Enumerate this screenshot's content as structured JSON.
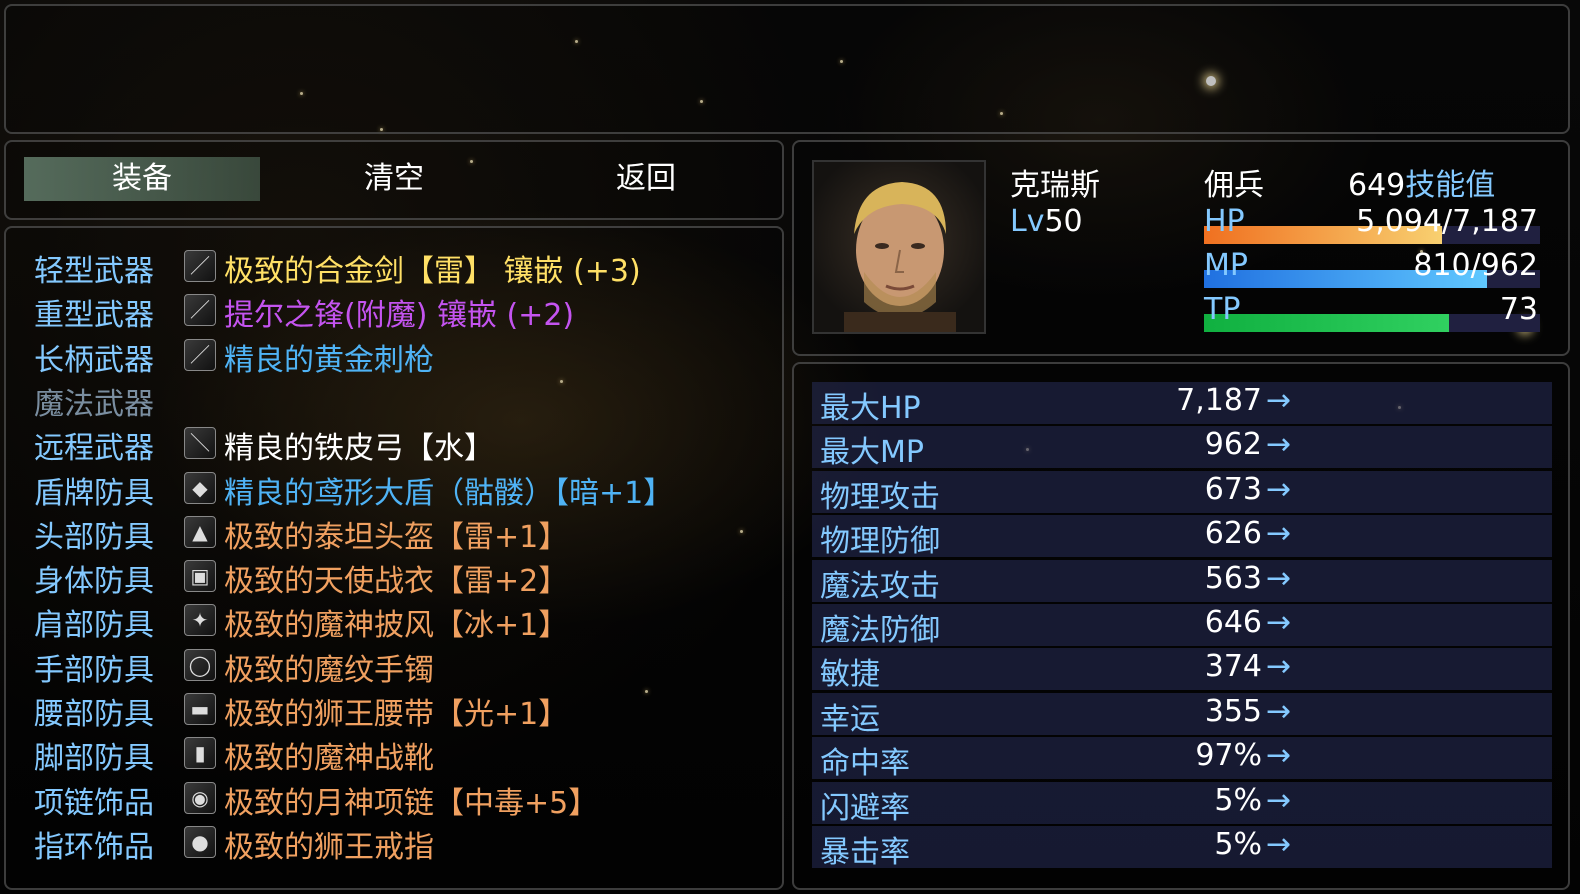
{
  "commands": [
    {
      "label": "装备",
      "selected": true
    },
    {
      "label": "清空",
      "selected": false
    },
    {
      "label": "返回",
      "selected": false
    }
  ],
  "slots": [
    {
      "slot": "轻型武器",
      "icon": "sword-icon",
      "glyph": "／",
      "item": "极致的合金剑【雷】 镶嵌 (+3)",
      "color": "#ffe066",
      "dim": false
    },
    {
      "slot": "重型武器",
      "icon": "greatsword-icon",
      "glyph": "／",
      "item": "提尔之锋(附魔) 镶嵌 (+2)",
      "color": "#c454f0",
      "dim": false
    },
    {
      "slot": "长柄武器",
      "icon": "spear-icon",
      "glyph": "／",
      "item": "精良的黄金刺枪",
      "color": "#4fb3f5",
      "dim": false
    },
    {
      "slot": "魔法武器",
      "icon": "",
      "glyph": "",
      "item": "",
      "color": "#ffffff",
      "dim": true
    },
    {
      "slot": "远程武器",
      "icon": "bow-icon",
      "glyph": "＼",
      "item": "精良的铁皮弓【水】",
      "color": "#ffffff",
      "dim": false
    },
    {
      "slot": "盾牌防具",
      "icon": "shield-icon",
      "glyph": "◆",
      "item": "精良的鸢形大盾（骷髅）【暗+1】",
      "color": "#4fb3f5",
      "dim": false
    },
    {
      "slot": "头部防具",
      "icon": "helmet-icon",
      "glyph": "▲",
      "item": "极致的泰坦头盔【雷+1】",
      "color": "#f0a060",
      "dim": false
    },
    {
      "slot": "身体防具",
      "icon": "armor-icon",
      "glyph": "▣",
      "item": "极致的天使战衣【雷+2】",
      "color": "#f0a060",
      "dim": false
    },
    {
      "slot": "肩部防具",
      "icon": "cloak-icon",
      "glyph": "✦",
      "item": "极致的魔神披风【冰+1】",
      "color": "#f0a060",
      "dim": false
    },
    {
      "slot": "手部防具",
      "icon": "bracelet-icon",
      "glyph": "◯",
      "item": "极致的魔纹手镯",
      "color": "#f0a060",
      "dim": false
    },
    {
      "slot": "腰部防具",
      "icon": "belt-icon",
      "glyph": "▬",
      "item": "极致的狮王腰带【光+1】",
      "color": "#f0a060",
      "dim": false
    },
    {
      "slot": "脚部防具",
      "icon": "boots-icon",
      "glyph": "▮",
      "item": "极致的魔神战靴",
      "color": "#f0a060",
      "dim": false
    },
    {
      "slot": "项链饰品",
      "icon": "necklace-icon",
      "glyph": "◉",
      "item": "极致的月神项链【中毒+5】",
      "color": "#f0a060",
      "dim": false
    },
    {
      "slot": "指环饰品",
      "icon": "ring-icon",
      "glyph": "●",
      "item": "极致的狮王戒指",
      "color": "#f0a060",
      "dim": false
    }
  ],
  "actor": {
    "name": "克瑞斯",
    "level_label": "Lv",
    "level": "50",
    "class": "佣兵",
    "skill_points": "649",
    "skill_points_label": "技能值",
    "hp_label": "HP",
    "hp": "5,094/7,187",
    "hp_ratio": 0.709,
    "mp_label": "MP",
    "mp": "810/962",
    "mp_ratio": 0.842,
    "tp_label": "TP",
    "tp": "73",
    "tp_ratio": 0.73
  },
  "params": [
    {
      "name": "最大HP",
      "value": "7,187"
    },
    {
      "name": "最大MP",
      "value": "962"
    },
    {
      "name": "物理攻击",
      "value": "673"
    },
    {
      "name": "物理防御",
      "value": "626"
    },
    {
      "name": "魔法攻击",
      "value": "563"
    },
    {
      "name": "魔法防御",
      "value": "646"
    },
    {
      "name": "敏捷",
      "value": "374"
    },
    {
      "name": "幸运",
      "value": "355"
    },
    {
      "name": "命中率",
      "value": "97%"
    },
    {
      "name": "闪避率",
      "value": "5%"
    },
    {
      "name": "暴击率",
      "value": "5%"
    }
  ],
  "arrow": "→",
  "colors": {
    "system": "#84c9ff",
    "hp_gauge": [
      "#f07020",
      "#f8d070"
    ],
    "mp_gauge": [
      "#2070e0",
      "#60c8ff"
    ],
    "tp_gauge": [
      "#10b040",
      "#30d060"
    ]
  }
}
